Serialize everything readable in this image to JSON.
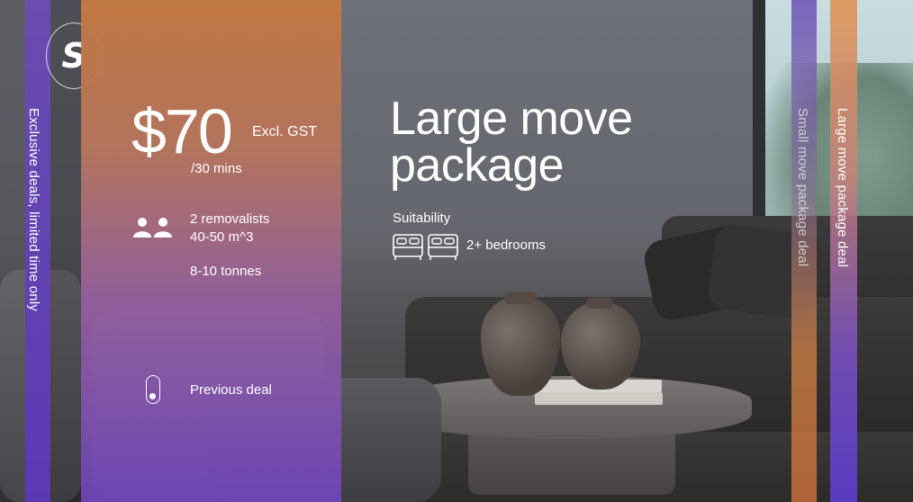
{
  "logo": {
    "letter": "S"
  },
  "side_left": {
    "text": "Exclusive deals, limited time only"
  },
  "deal": {
    "price": "$70",
    "price_note": "Excl. GST",
    "per": "/30 mins",
    "removalists": "2 removalists",
    "volume": "40-50 m^3",
    "weight": "8-10 tonnes",
    "previous_label": "Previous deal"
  },
  "package": {
    "title": "Large move package",
    "suitability_label": "Suitability",
    "bedrooms": "2+ bedrooms"
  },
  "side_right": {
    "tab1": "Small move package deal",
    "tab2": "Large move package deal"
  },
  "colors": {
    "accent_purple": "#5b39b4",
    "accent_orange": "#c47840",
    "text": "#ffffff"
  },
  "icons": [
    "logo-s-icon",
    "people-icon",
    "toggle-icon",
    "bed-icon"
  ]
}
